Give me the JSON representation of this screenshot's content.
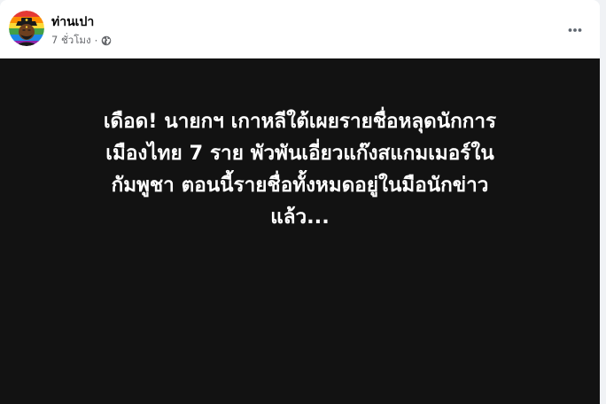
{
  "post": {
    "author": {
      "name": "ท่านเปา",
      "avatar_icon": "judge-bao-avatar-icon"
    },
    "meta": {
      "time": "7 ชั่วโมง",
      "separator": "·",
      "audience_icon": "globe-icon"
    },
    "more_icon": "more-horizontal-icon",
    "media": {
      "background": "#121212",
      "text_color": "#ffffff",
      "lines": [
        "เดือด! นายกฯ เกาหลีใต้เผยรายชื่อหลุดนักการ",
        "เมืองไทย 7 ราย พัวพันเอี่ยวแก๊งสแกมเมอร์ใน",
        "กัมพูชา ตอนนี้รายชื่อทั้งหมดอยู่ในมือนักข่าว",
        "แล้ว..."
      ]
    }
  }
}
